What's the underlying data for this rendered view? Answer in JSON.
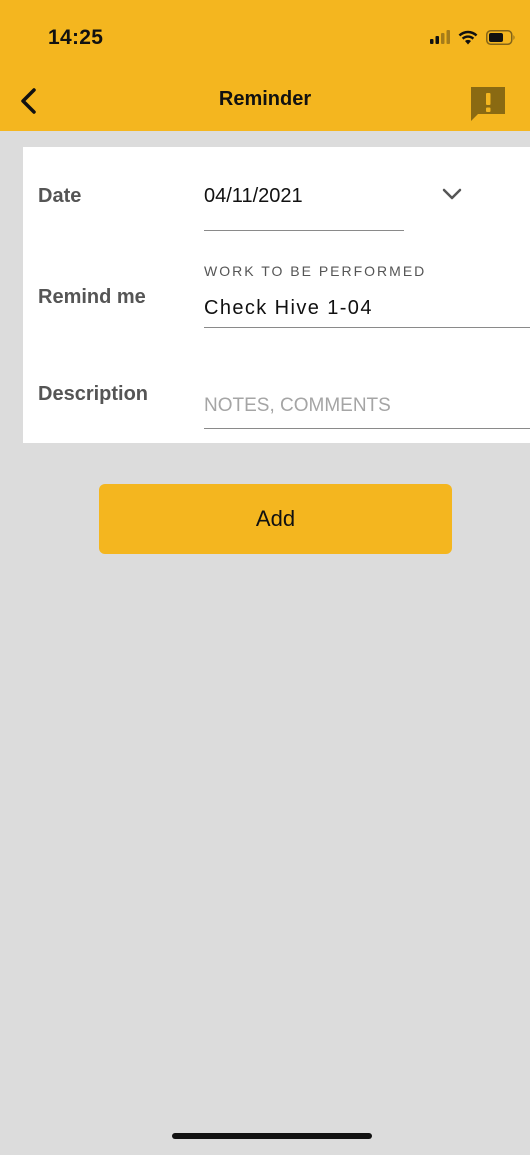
{
  "status_bar": {
    "time": "14:25",
    "icons": [
      "signal-icon",
      "wifi-icon",
      "battery-icon"
    ]
  },
  "nav": {
    "title": "Reminder",
    "back_icon": "chevron-left-icon",
    "alert_icon": "report-alert-icon"
  },
  "form": {
    "date": {
      "label": "Date",
      "value": "04/11/2021"
    },
    "remind_me": {
      "label": "Remind me",
      "caption": "WORK TO BE PERFORMED",
      "value": "Check Hive 1-04"
    },
    "description": {
      "label": "Description",
      "placeholder": "NOTES, COMMENTS",
      "value": ""
    }
  },
  "actions": {
    "add_label": "Add"
  },
  "colors": {
    "accent": "#f4b61f",
    "background": "#dcdcdc",
    "card": "#ffffff",
    "label_text": "#555555",
    "placeholder": "#a5a5a5"
  }
}
